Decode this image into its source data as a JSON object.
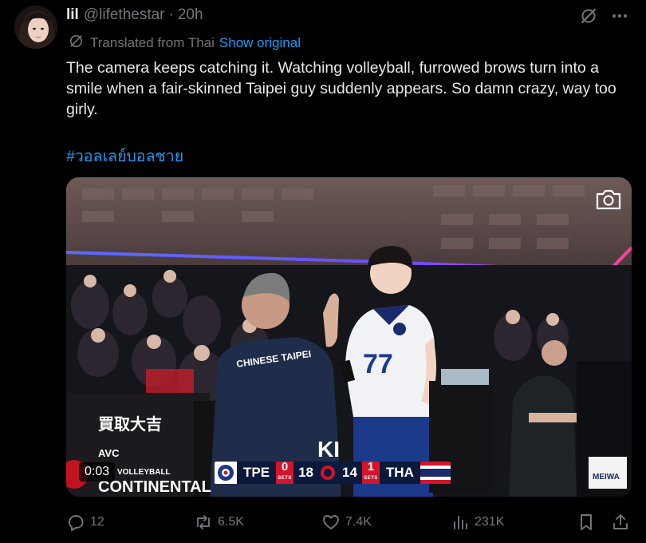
{
  "user": {
    "display_name": "lil",
    "handle": "@lifethestar",
    "separator": "·",
    "time": "20h"
  },
  "translation": {
    "label": "Translated from Thai",
    "show_original": "Show original"
  },
  "tweet": {
    "text": "The camera keeps catching it. Watching volleyball, furrowed brows turn into a smile when a fair-skinned Taipei guy suddenly appears. So damn crazy, way too girly.",
    "hashtag": "#วอลเลย์บอลชาย"
  },
  "media": {
    "duration": "0:03",
    "jacket_text": "CHINESE TAIPEI",
    "jersey_number": "77",
    "sponsor_text": "買取大吉",
    "avc_text": "AVC",
    "volleyball_text": "VOLLEYBALL",
    "continental_text": "CONTINENTAL",
    "ki_text": "KI",
    "meiwa_text": "MEIWA",
    "scoreboard": {
      "team_a": "TPE",
      "team_a_sets": "0",
      "team_a_points": "18",
      "team_b_points": "14",
      "team_b_sets": "1",
      "team_b": "THA",
      "sets_label": "SETS"
    }
  },
  "actions": {
    "replies": "12",
    "reposts": "6.5K",
    "likes": "7.4K",
    "views": "231K"
  },
  "icons": {
    "grok": "grok-icon",
    "more": "more-icon",
    "translate": "translate-icon",
    "camera": "camera-icon",
    "reply": "reply-icon",
    "repost": "repost-icon",
    "like": "heart-icon",
    "views": "views-icon",
    "bookmark": "bookmark-icon",
    "share": "share-icon"
  },
  "colors": {
    "background": "#000000",
    "text": "#e7e9ea",
    "secondary": "#71767b",
    "accent": "#1d9bf0"
  }
}
